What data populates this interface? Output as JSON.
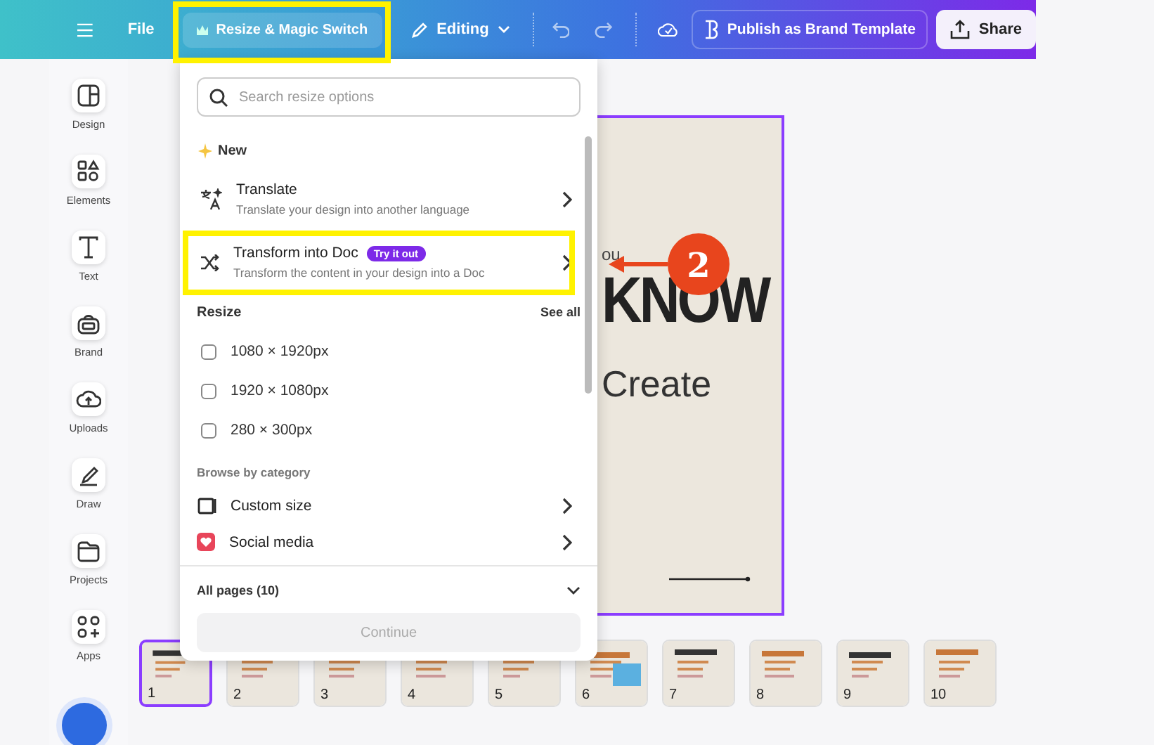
{
  "topbar": {
    "file": "File",
    "resize_button": {
      "label": "Resize & Magic Switch",
      "highlighted": true
    },
    "editing": "Editing",
    "publish": "Publish as Brand Template",
    "share": "Share"
  },
  "sidebar": {
    "items": [
      {
        "label": "Design",
        "kind": "design"
      },
      {
        "label": "Elements",
        "kind": "elements"
      },
      {
        "label": "Text",
        "kind": "text"
      },
      {
        "label": "Brand",
        "kind": "brand"
      },
      {
        "label": "Uploads",
        "kind": "uploads"
      },
      {
        "label": "Draw",
        "kind": "draw"
      },
      {
        "label": "Projects",
        "kind": "projects"
      },
      {
        "label": "Apps",
        "kind": "apps"
      }
    ]
  },
  "canvas": {
    "texts": [
      "ou",
      "KNOW",
      "Create"
    ]
  },
  "dropdown": {
    "search": {
      "placeholder": "Search resize options"
    },
    "new_heading": "New",
    "features": [
      {
        "kind": "translate",
        "title": "Translate",
        "subtitle": "Translate your design into another language",
        "highlighted": false
      },
      {
        "kind": "transform",
        "title": "Transform into Doc",
        "badge": "Try it out",
        "subtitle": "Transform the content in your design into a Doc",
        "highlighted": true
      }
    ],
    "resize_heading": "Resize",
    "see_all": "See all",
    "sizes": [
      {
        "label": "1080 × 1920px",
        "checked": false
      },
      {
        "label": "1920 × 1080px",
        "checked": false
      },
      {
        "label": "280 × 300px",
        "checked": false
      }
    ],
    "category_heading": "Browse by category",
    "categories": [
      {
        "kind": "custom",
        "label": "Custom size"
      },
      {
        "kind": "social",
        "label": "Social media"
      }
    ],
    "pages": "All pages (10)",
    "continue": {
      "label": "Continue",
      "disabled": true
    }
  },
  "annotation": {
    "number": "2"
  },
  "thumbnails": [
    {
      "number": "1",
      "selected": true
    },
    {
      "number": "2",
      "selected": false
    },
    {
      "number": "3",
      "selected": false
    },
    {
      "number": "4",
      "selected": false
    },
    {
      "number": "5",
      "selected": false
    },
    {
      "number": "6",
      "selected": false
    },
    {
      "number": "7",
      "selected": false
    },
    {
      "number": "8",
      "selected": false
    },
    {
      "number": "9",
      "selected": false
    },
    {
      "number": "10",
      "selected": false
    }
  ]
}
